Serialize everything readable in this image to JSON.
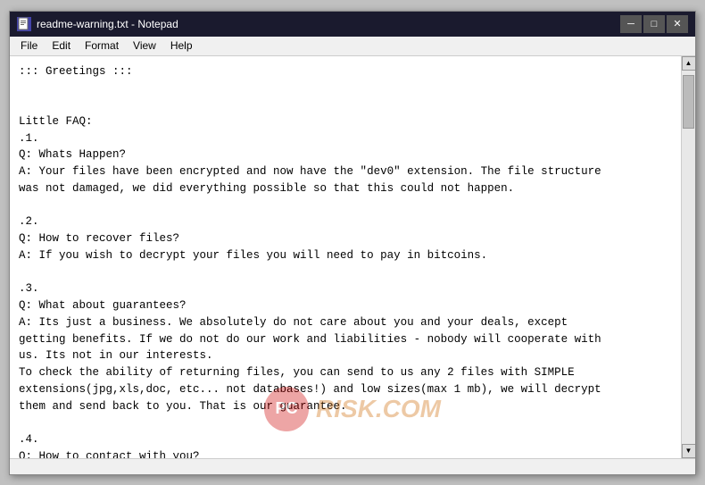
{
  "window": {
    "title": "readme-warning.txt - Notepad",
    "icon": "notepad-icon"
  },
  "titlebar": {
    "minimize_label": "─",
    "maximize_label": "□",
    "close_label": "✕"
  },
  "menubar": {
    "items": [
      {
        "label": "File"
      },
      {
        "label": "Edit"
      },
      {
        "label": "Format"
      },
      {
        "label": "View"
      },
      {
        "label": "Help"
      }
    ]
  },
  "content": {
    "text": "::: Greetings :::\n\n\nLittle FAQ:\n.1.\nQ: Whats Happen?\nA: Your files have been encrypted and now have the \"dev0\" extension. The file structure\nwas not damaged, we did everything possible so that this could not happen.\n\n.2.\nQ: How to recover files?\nA: If you wish to decrypt your files you will need to pay in bitcoins.\n\n.3.\nQ: What about guarantees?\nA: Its just a business. We absolutely do not care about you and your deals, except\ngetting benefits. If we do not do our work and liabilities - nobody will cooperate with\nus. Its not in our interests.\nTo check the ability of returning files, you can send to us any 2 files with SIMPLE\nextensions(jpg,xls,doc, etc... not databases!) and low sizes(max 1 mb), we will decrypt\nthem and send back to you. That is our guarantee.\n\n.4.\nQ: How to contact with you?\nA: You can write us to our mailbox: xdatarecovery@msgsafe.io or bobwhite@cock.li"
  },
  "watermark": {
    "logo_text": "PC",
    "text": "RISK.COM"
  },
  "scrollbar": {
    "up_arrow": "▲",
    "down_arrow": "▼"
  }
}
